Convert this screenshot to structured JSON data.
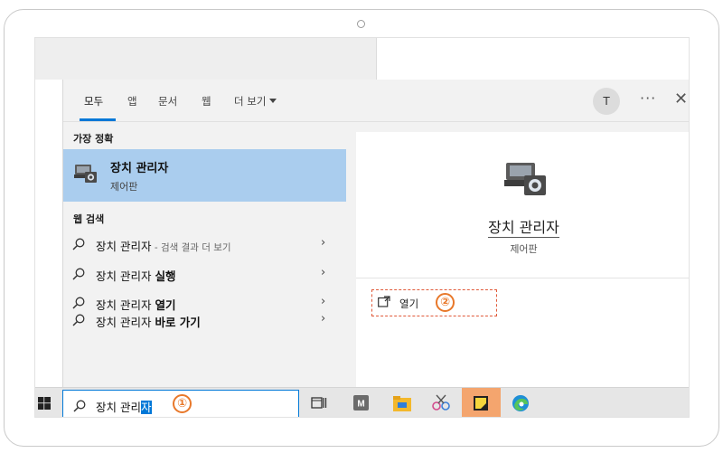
{
  "tabs": [
    {
      "label": "모두"
    },
    {
      "label": "앱"
    },
    {
      "label": "문서"
    },
    {
      "label": "웹"
    },
    {
      "label": "더 보기"
    }
  ],
  "header": {
    "avatar_initial": "T",
    "more_label": "···",
    "close_label": "✕"
  },
  "best_match": {
    "section_label": "가장 정확",
    "title": "장치 관리자",
    "subtitle": "제어판"
  },
  "web_search": {
    "section_label": "웹 검색",
    "items": [
      {
        "text": "장치 관리자",
        "bold": "",
        "suffix": " - 검색 결과 더 보기"
      },
      {
        "text": "장치 관리자 ",
        "bold": "실행",
        "suffix": ""
      },
      {
        "text": "장치 관리자 ",
        "bold": "열기",
        "suffix": ""
      },
      {
        "text": "장치 관리자 ",
        "bold": "바로 가기",
        "suffix": ""
      }
    ],
    "chevron": "›"
  },
  "detail": {
    "title": "장치 관리자",
    "subtitle": "제어판",
    "open_label": "열기"
  },
  "search": {
    "typed": "장치 관리",
    "selected": "자"
  },
  "badges": {
    "one": "①",
    "two": "②"
  },
  "colors": {
    "accent": "#0078d7",
    "selection_bg": "#aacdee",
    "annotation": "#e8782a"
  },
  "taskbar_icons": [
    "task-view-icon",
    "m-app-icon",
    "file-explorer-icon",
    "snipping-icon",
    "sticky-notes-icon",
    "edge-icon"
  ]
}
